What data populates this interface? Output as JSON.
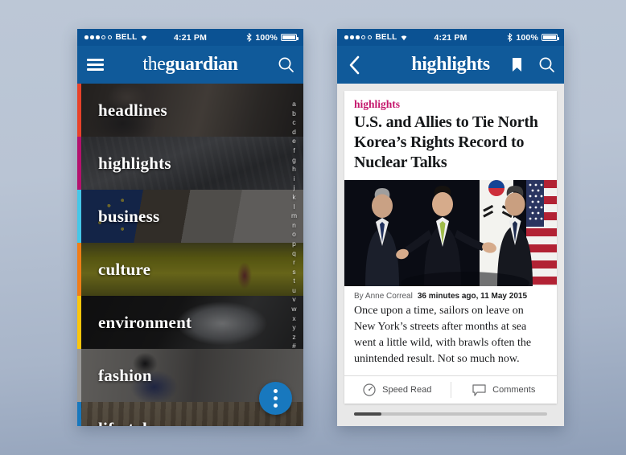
{
  "background_color": "#b9c4d4",
  "status_bar": {
    "signal_filled": 3,
    "signal_empty": 2,
    "carrier": "BELL",
    "wifi_icon": "wifi-icon",
    "time": "4:21 PM",
    "bluetooth_icon": "bluetooth-icon",
    "battery_percent": "100%",
    "battery_icon": "battery-full-icon"
  },
  "left_phone": {
    "nav": {
      "menu_icon": "hamburger-icon",
      "brand_thin": "the",
      "brand_bold": "guardian",
      "search_icon": "search-icon"
    },
    "menu_items": [
      {
        "label": "headlines",
        "color": "#e8422a",
        "photo": "ph-headlines"
      },
      {
        "label": "highlights",
        "color": "#b4126e",
        "photo": "ph-highlights"
      },
      {
        "label": "business",
        "color": "#45c7e8",
        "photo": "ph-business"
      },
      {
        "label": "culture",
        "color": "#f07d18",
        "photo": "ph-culture"
      },
      {
        "label": "environment",
        "color": "#fcc50b",
        "photo": "ph-environment"
      },
      {
        "label": "fashion",
        "color": "#9a9a9a",
        "photo": "ph-fashion"
      },
      {
        "label": "lifestyle",
        "color": "#1878be",
        "photo": "ph-lifestyle"
      }
    ],
    "alphabet_index": [
      "a",
      "b",
      "c",
      "d",
      "e",
      "f",
      "g",
      "h",
      "i",
      "j",
      "k",
      "l",
      "m",
      "n",
      "o",
      "p",
      "q",
      "r",
      "s",
      "t",
      "u",
      "v",
      "w",
      "x",
      "y",
      "z",
      "#"
    ],
    "fab": {
      "icon": "more-vertical-icon",
      "color": "#1878be"
    }
  },
  "right_phone": {
    "nav": {
      "back_icon": "chevron-left-icon",
      "title": "highlights",
      "bookmark_icon": "bookmark-icon",
      "search_icon": "search-icon"
    },
    "article": {
      "kicker": "highlights",
      "kicker_color": "#c4176c",
      "headline": "U.S. and Allies to Tie North Korea’s Rights Record to Nuclear Talks",
      "photo_alt": "three-diplomats-photo",
      "byline_author": "By Anne Correal",
      "byline_time": "36 minutes ago, 11 May 2015",
      "body": "Once upon a time, sailors on leave on New York’s streets after months at sea went a little wild, with brawls often the unintended result. Not so much now.",
      "actions": [
        {
          "label": "Speed Read",
          "icon": "speedometer-icon"
        },
        {
          "label": "Comments",
          "icon": "comment-bubble-icon"
        }
      ]
    },
    "pager": {
      "progress_percent": 14
    }
  }
}
